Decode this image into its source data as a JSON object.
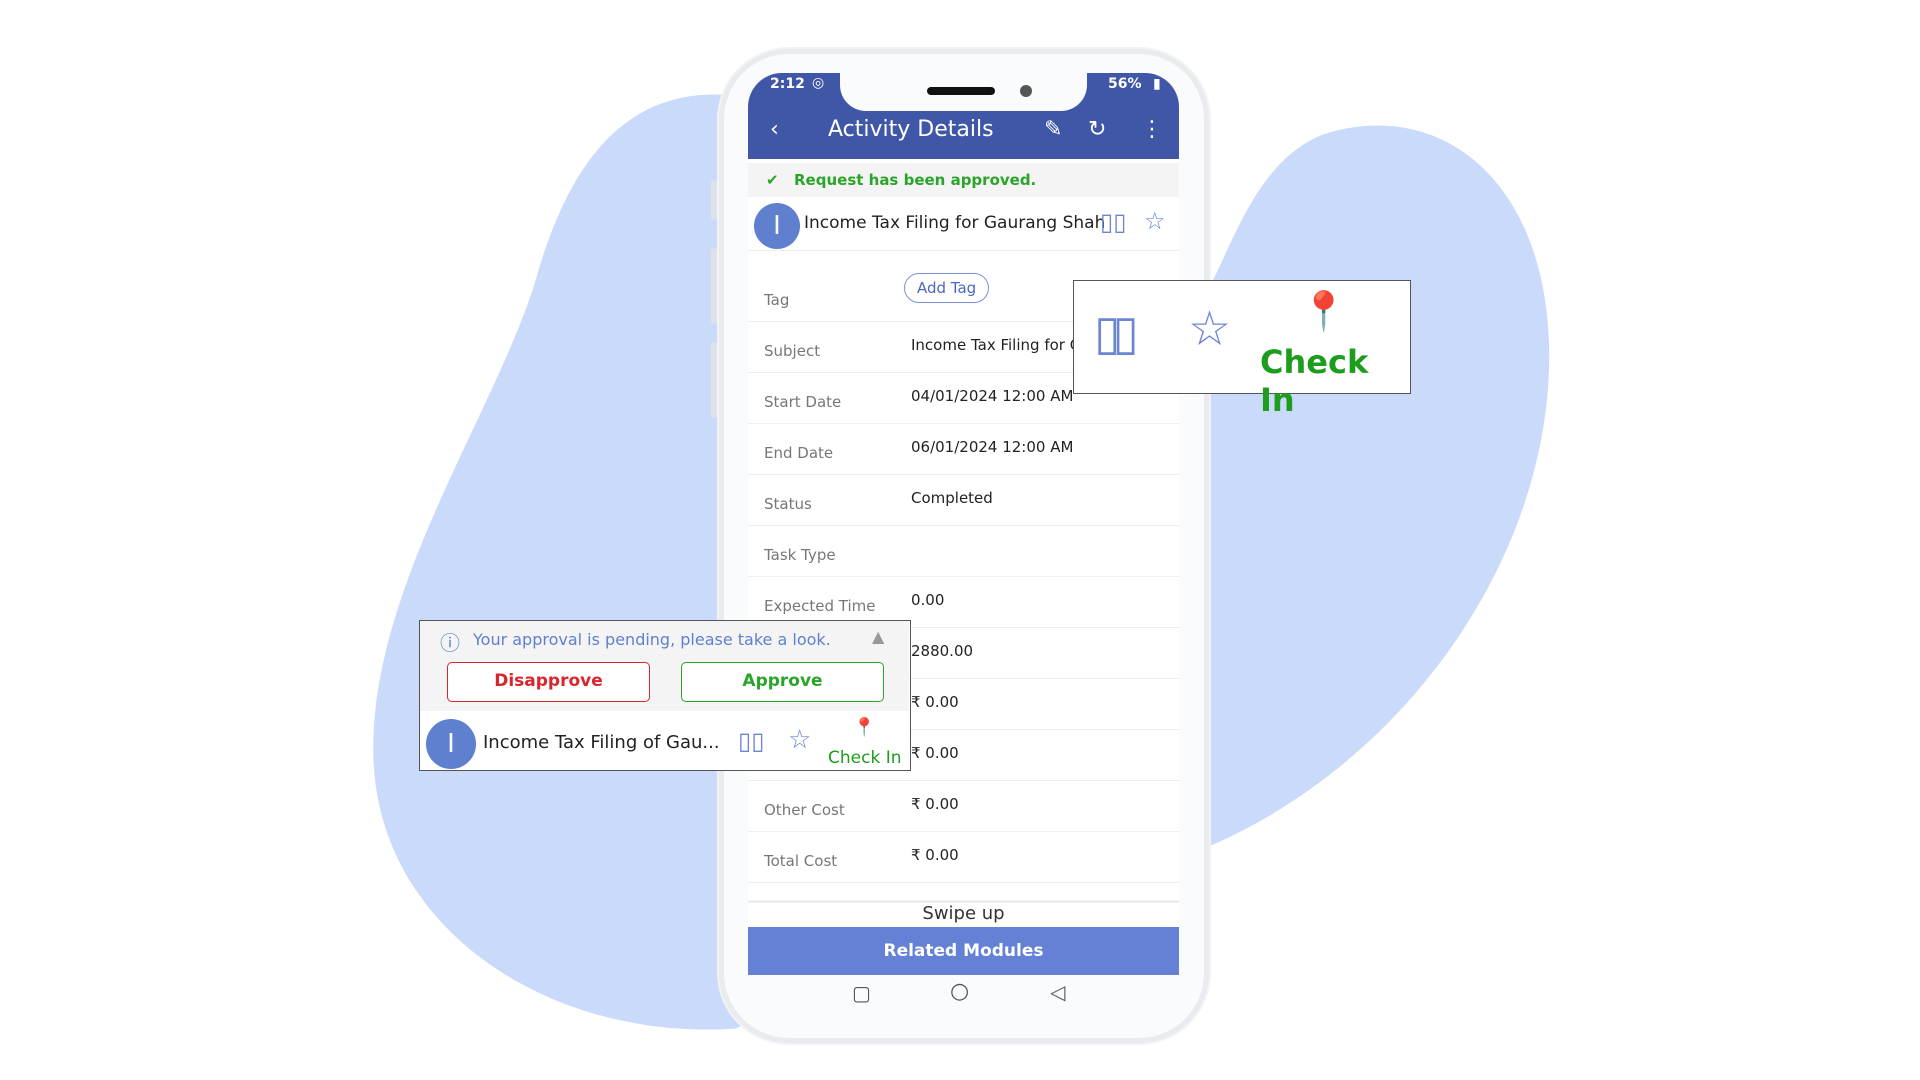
{
  "colors": {
    "blob": "#c9dafb",
    "header": "#3f57a6",
    "accent": "#5f7fcf",
    "approved": "#2aa52a",
    "disapprove": "#d9252d",
    "approve": "#2aa52a",
    "related": "#6581d6"
  },
  "status_bar": {
    "time": "2:12",
    "battery": "56%"
  },
  "header": {
    "title": "Activity Details",
    "icons": [
      "back-icon",
      "pencil-icon",
      "refresh-icon",
      "more-vert-icon"
    ]
  },
  "banner": {
    "text": "Request has been approved."
  },
  "record": {
    "avatar_letter": "I",
    "title": "Income Tax Filing for Gaurang Shah"
  },
  "fields": [
    {
      "label": "Tag",
      "button": "Add Tag"
    },
    {
      "label": "Subject",
      "value": "Income Tax Filing for Ga"
    },
    {
      "label": "Start Date",
      "value": "04/01/2024 12:00 AM"
    },
    {
      "label": "End Date",
      "value": "06/01/2024 12:00 AM"
    },
    {
      "label": "Status",
      "value": "Completed"
    },
    {
      "label": "Task Type",
      "value": ""
    },
    {
      "label": "Expected Time",
      "value": "0.00"
    },
    {
      "label": "",
      "value": "2880.00"
    },
    {
      "label": "",
      "value": "₹ 0.00"
    },
    {
      "label": "",
      "value": "₹ 0.00"
    },
    {
      "label": "Other Cost",
      "value": "₹ 0.00"
    },
    {
      "label": "Total Cost",
      "value": "₹ 0.00"
    }
  ],
  "footer": {
    "swipe": "Swipe up",
    "related": "Related Modules"
  },
  "callout_right": {
    "check_in": "Check In"
  },
  "callout_left": {
    "pending": "Your approval is pending, please take a look.",
    "disapprove": "Disapprove",
    "approve": "Approve",
    "avatar_letter": "I",
    "title": "Income Tax Filing of Gau...",
    "check_in": "Check In"
  }
}
